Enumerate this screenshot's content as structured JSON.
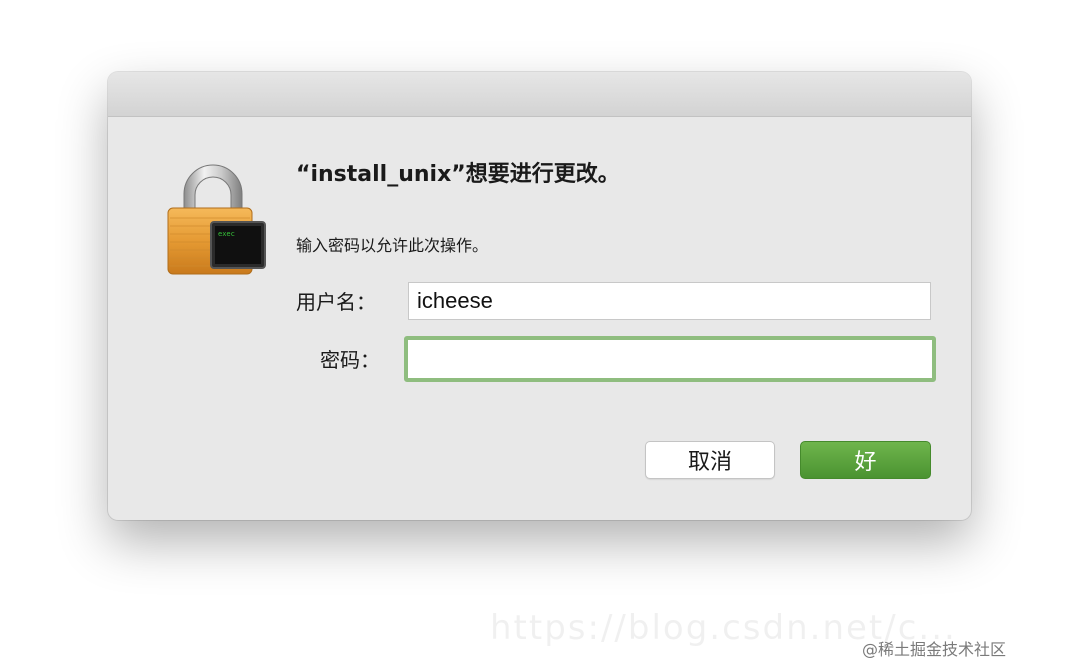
{
  "dialog": {
    "heading": "“install_unix”想要进行更改。",
    "subtext": "输入密码以允许此次操作。",
    "lock_badge_text": "exec",
    "username_label": "用户名：",
    "username_value": "icheese",
    "password_label": "密码：",
    "password_value": "",
    "cancel_label": "取消",
    "ok_label": "好"
  },
  "watermark": {
    "text": "@稀土掘金技术社区",
    "url_faint": "https://blog.csdn.net/c..."
  },
  "colors": {
    "dialog_bg": "#e8e8e8",
    "ok_button": "#5aa13c",
    "focus_ring": "#8fbd7f",
    "lock_gold": "#e8a445",
    "terminal_text": "#36c23a"
  },
  "icons": {
    "lock": "padlock-with-terminal-icon"
  }
}
